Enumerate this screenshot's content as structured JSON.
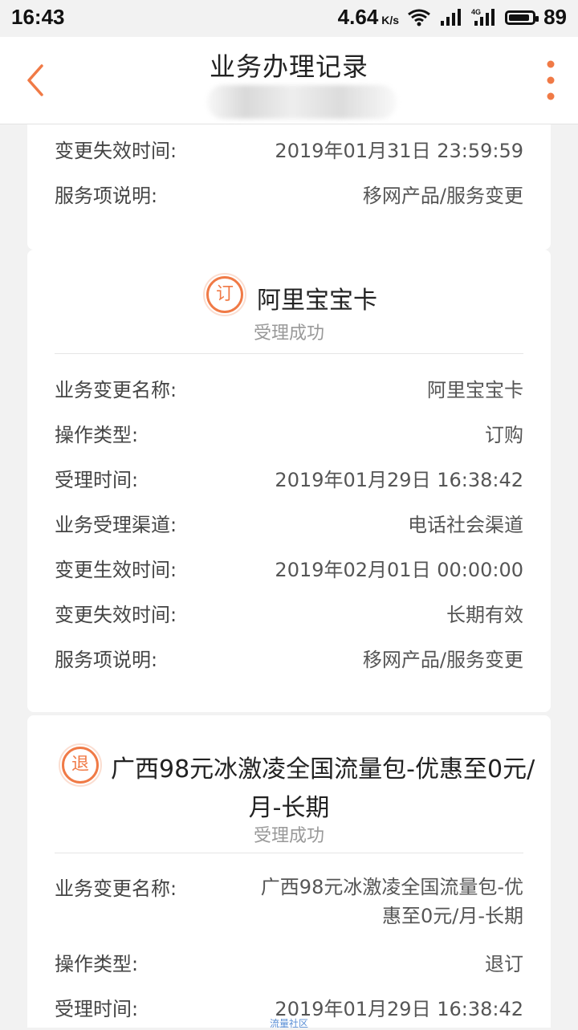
{
  "status_bar": {
    "time": "16:43",
    "speed": "4.64",
    "speed_unit": "K/s",
    "battery": "89",
    "battery_level": 0.89
  },
  "header": {
    "title": "业务办理记录"
  },
  "labels": {
    "change_name": "业务变更名称:",
    "operation_type": "操作类型:",
    "accept_time": "受理时间:",
    "channel": "业务受理渠道:",
    "effective_time": "变更生效时间:",
    "expire_time": "变更失效时间:",
    "service_desc": "服务项说明:"
  },
  "record0": {
    "expire_time": "2019年01月31日 23:59:59",
    "service_desc": "移网产品/服务变更"
  },
  "record1": {
    "badge": "订",
    "title": "阿里宝宝卡",
    "status": "受理成功",
    "change_name": "阿里宝宝卡",
    "operation_type": "订购",
    "accept_time": "2019年01月29日 16:38:42",
    "channel": "电话社会渠道",
    "effective_time": "2019年02月01日 00:00:00",
    "expire_time": "长期有效",
    "service_desc": "移网产品/服务变更"
  },
  "record2": {
    "badge": "退",
    "title_line1": "广西98元冰激凌全国流量包-优惠至0元/",
    "title_line2": "月-长期",
    "status": "受理成功",
    "change_name_line1": "广西98元冰激凌全国流量包-优",
    "change_name_line2": "惠至0元/月-长期",
    "operation_type": "退订",
    "accept_time": "2019年01月29日 16:38:42"
  },
  "watermark": "流量社区"
}
